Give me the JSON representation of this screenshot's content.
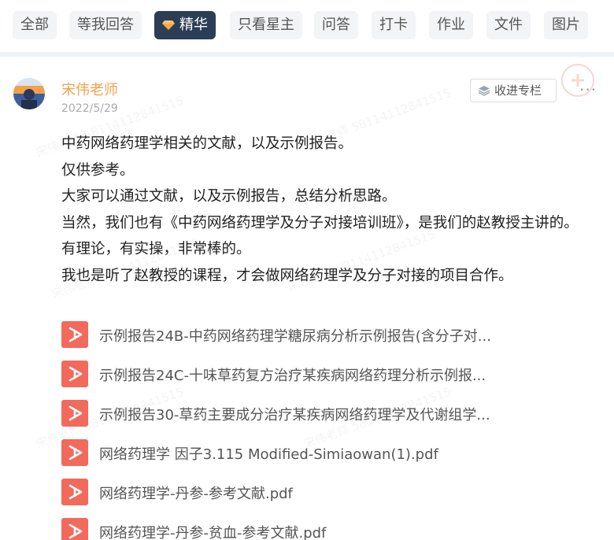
{
  "filters": [
    {
      "label": "全部",
      "active": false
    },
    {
      "label": "等我回答",
      "active": false
    },
    {
      "label": "精华",
      "active": true
    },
    {
      "label": "只看星主",
      "active": false
    },
    {
      "label": "问答",
      "active": false
    },
    {
      "label": "打卡",
      "active": false
    },
    {
      "label": "作业",
      "active": false
    },
    {
      "label": "文件",
      "active": false
    },
    {
      "label": "图片",
      "active": false
    }
  ],
  "post": {
    "author": "宋伟老师",
    "date": "2022/5/29",
    "column_button": "收进专栏",
    "more": "···",
    "paragraphs": [
      "中药网络药理学相关的文献，以及示例报告。",
      "仅供参考。",
      "大家可以通过文献，以及示例报告，总结分析思路。",
      "当然，我们也有《中药网络药理学及分子对接培训班》，是我们的赵教授主讲的。",
      "有理论，有实操，非常棒的。",
      "我也是听了赵教授的课程，才会做网络药理学及分子对接的项目合作。"
    ],
    "files": [
      {
        "name": "示例报告24B-中药网络药理学糖尿病分析示例报告(含分子对...",
        "icon": "pdf-icon"
      },
      {
        "name": "示例报告24C-十味草药复方治疗某疾病网络药理分析示例报...",
        "icon": "pdf-icon"
      },
      {
        "name": "示例报告30-草药主要成分治疗某疾病网络药理学及代谢组学...",
        "icon": "pdf-icon"
      },
      {
        "name": "网络药理学 因子3.115 Modified-Simiaowan(1).pdf",
        "icon": "pdf-icon"
      },
      {
        "name": "网络药理学-丹参-参考文献.pdf",
        "icon": "pdf-icon"
      },
      {
        "name": "网络药理学-丹参-贫血-参考文献.pdf",
        "icon": "pdf-icon"
      }
    ]
  },
  "watermark": "宋伟老师 58114112841515",
  "colors": {
    "active_chip": "#2c3e55",
    "author": "#f3a24b",
    "pdf": "#f16a5c"
  }
}
